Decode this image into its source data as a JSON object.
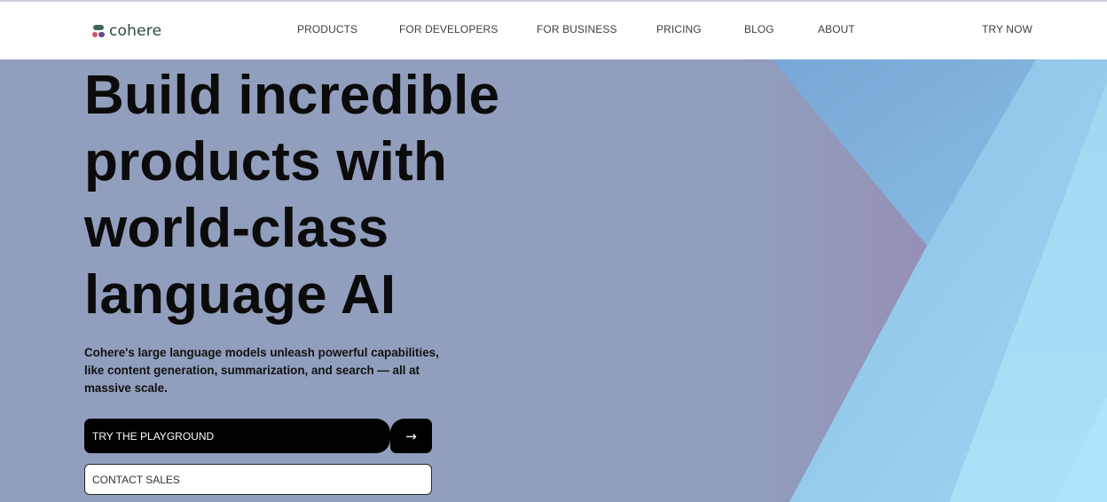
{
  "brand": {
    "name": "cohere",
    "mark_colors": [
      "#3d6b55",
      "#d4566b",
      "#6b4b8c"
    ]
  },
  "nav": {
    "items": [
      "PRODUCTS",
      "FOR DEVELOPERS",
      "FOR BUSINESS",
      "PRICING",
      "BLOG",
      "ABOUT"
    ],
    "cta": "TRY NOW"
  },
  "hero": {
    "headline": [
      "Build incredible",
      "products with",
      "world-class",
      "language AI"
    ],
    "subtext": "Cohere's large language models unleash powerful capabilities, like content generation, summarization, and search — all at massive scale.",
    "primary_cta": "TRY THE PLAYGROUND",
    "arrow_icon": "→",
    "secondary_cta": "CONTACT SALES"
  },
  "colors": {
    "hero_background": "#919ebd",
    "accent_blue": "#7fb0dc",
    "accent_light_blue": "#a3d9f2"
  }
}
